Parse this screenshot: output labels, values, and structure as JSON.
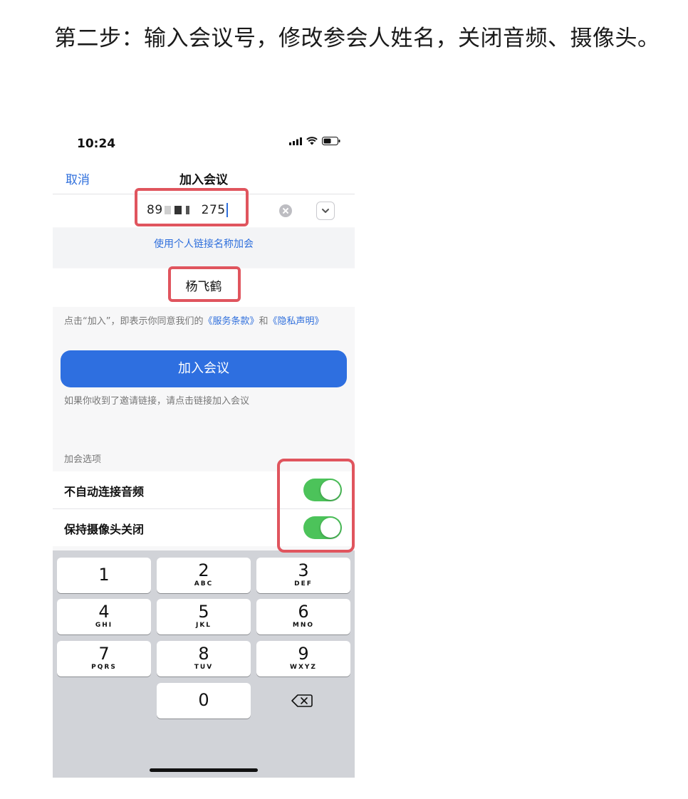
{
  "caption": "第二步：输入会议号，修改参会人姓名，关闭音频、摄像头。",
  "status_bar": {
    "time": "10:24",
    "icons": [
      "signal-icon",
      "wifi-icon",
      "battery-icon"
    ]
  },
  "nav": {
    "cancel_label": "取消",
    "title": "加入会议"
  },
  "meeting_id": {
    "prefix": "89",
    "suffix": "275"
  },
  "personal_link_label": "使用个人链接名称加会",
  "participant_name": "杨飞鹤",
  "terms": {
    "text_before": "点击“加入”，即表示你同意我们的",
    "terms_link": "《服务条款》",
    "conjunction": "和",
    "privacy_link": "《隐私声明》"
  },
  "join_button_label": "加入会议",
  "invite_hint": "如果你收到了邀请链接，请点击链接加入会议",
  "options": {
    "header": "加会选项",
    "items": [
      {
        "label": "不自动连接音频",
        "enabled": true
      },
      {
        "label": "保持摄像头关闭",
        "enabled": true
      }
    ]
  },
  "keypad": {
    "keys": [
      {
        "num": "1",
        "letters": ""
      },
      {
        "num": "2",
        "letters": "ABC"
      },
      {
        "num": "3",
        "letters": "DEF"
      },
      {
        "num": "4",
        "letters": "GHI"
      },
      {
        "num": "5",
        "letters": "JKL"
      },
      {
        "num": "6",
        "letters": "MNO"
      },
      {
        "num": "7",
        "letters": "PQRS"
      },
      {
        "num": "8",
        "letters": "TUV"
      },
      {
        "num": "9",
        "letters": "WXYZ"
      },
      {
        "num": "0",
        "letters": ""
      }
    ]
  },
  "colors": {
    "accent": "#2e6fe0",
    "toggle_on": "#4cc35a",
    "annotation": "#e0555e"
  }
}
